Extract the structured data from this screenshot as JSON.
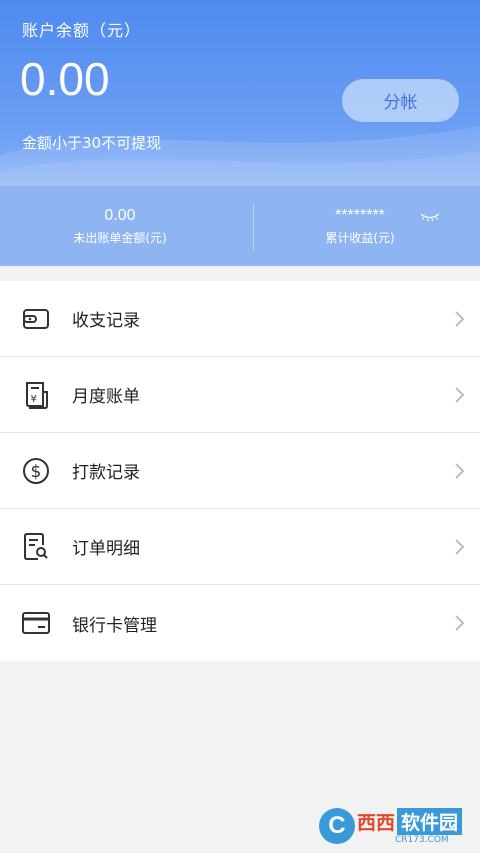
{
  "header": {
    "balance_title": "账户余额（元）",
    "balance_value": "0.00",
    "hint": "金额小于30不可提现",
    "split_button": "分帐"
  },
  "stats": {
    "unbilled_value": "0.00",
    "unbilled_label": "未出账单金额(元)",
    "total_value": "********",
    "total_label": "累计收益(元)"
  },
  "menu": {
    "items": [
      {
        "label": "收支记录",
        "icon": "wallet-icon"
      },
      {
        "label": "月度账单",
        "icon": "bill-icon"
      },
      {
        "label": "打款记录",
        "icon": "dollar-icon"
      },
      {
        "label": "订单明细",
        "icon": "order-search-icon"
      },
      {
        "label": "银行卡管理",
        "icon": "bank-card-icon"
      }
    ]
  },
  "watermark": {
    "logo_letter": "C",
    "text_main": "西西",
    "text_secondary": "软件园",
    "site": "CR173.COM"
  },
  "colors": {
    "header_blue": "#4f8af0",
    "stats_blue": "#8eb4f2",
    "button_text": "#3f73d8"
  }
}
